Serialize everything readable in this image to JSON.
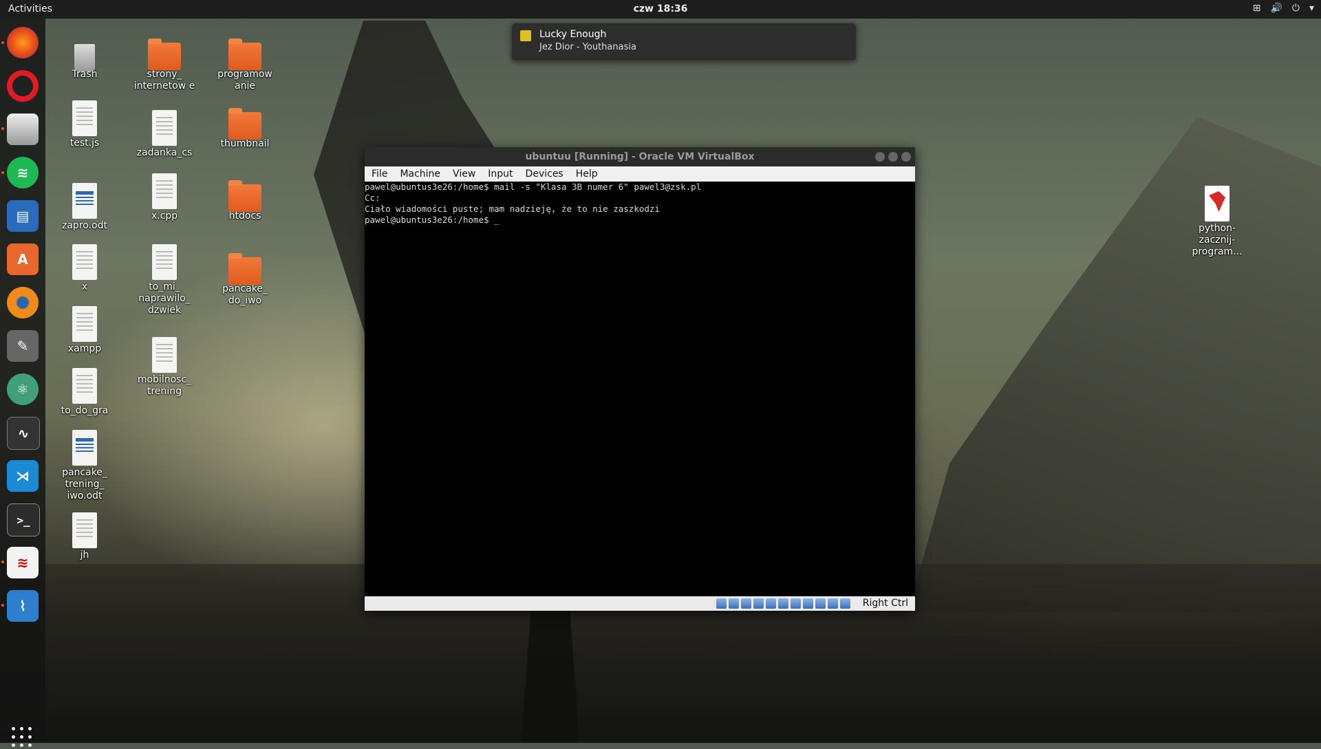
{
  "topbar": {
    "activities": "Activities",
    "clock": "czw 18:36",
    "tray_icons": [
      "network-icon",
      "volume-icon",
      "power-icon",
      "menu-arrow-icon"
    ]
  },
  "dock": {
    "apps": [
      "firefox",
      "opera",
      "files",
      "spotify",
      "libreoffice-writer",
      "ubuntu-software",
      "blender",
      "gimp",
      "atom",
      "system-monitor",
      "vscode",
      "terminal",
      "evince",
      "system-monitor-2"
    ]
  },
  "notification": {
    "title": "Lucky Enough",
    "body": "Jez Dior - Youthanasia"
  },
  "desktop": {
    "trash": "Trash",
    "strony": "strony_ internetow e",
    "programowanie": "programow anie",
    "testjs": "test.js",
    "zadanka": "zadanka_cs",
    "thumbnail": "thumbnail",
    "zapro": "zapro.odt",
    "xcpp": "x.cpp",
    "htdocs": "htdocs",
    "x": "x",
    "to_mi": "to_mi_ naprawilo_ dzwiek",
    "pancake_iwo": "pancake_ do_iwo",
    "xampp": "xampp",
    "mobilnosc": "mobilnosc_ trening",
    "to_do_gra": "to_do_gra",
    "pancake_trening": "pancake_ trening_ iwo.odt",
    "jh": "jh",
    "python": "python- zacznij- program..."
  },
  "vbox": {
    "title": "ubuntuu [Running] - Oracle VM VirtualBox",
    "menu": {
      "file": "File",
      "machine": "Machine",
      "view": "View",
      "input": "Input",
      "devices": "Devices",
      "help": "Help"
    },
    "terminal_lines": [
      "pawel@ubuntus3e26:/home$ mail -s \"Klasa 3B numer 6\" pawel3@zsk.pl",
      "Cc:",
      "Ciało wiadomości puste; mam nadzieję, że to nie zaszkodzi",
      "pawel@ubuntus3e26:/home$ _"
    ],
    "host_key": "Right Ctrl"
  }
}
